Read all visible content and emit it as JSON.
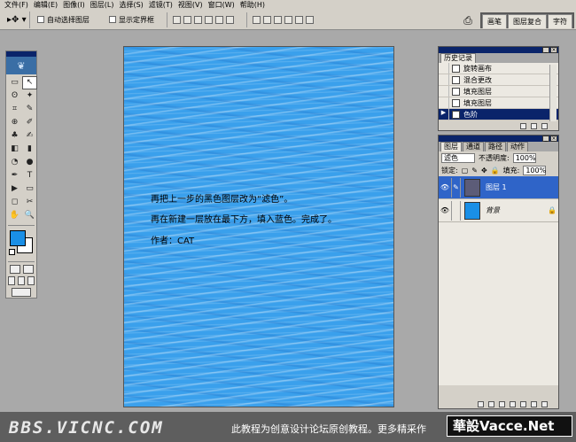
{
  "menu": [
    "文件(F)",
    "编辑(E)",
    "图像(I)",
    "图层(L)",
    "选择(S)",
    "滤镜(T)",
    "视图(V)",
    "窗口(W)",
    "帮助(H)"
  ],
  "options": {
    "auto_select_label": "自动选择图层",
    "show_bounds_label": "显示定界框",
    "right_tabs": [
      "画笔",
      "图层复合",
      "字符"
    ]
  },
  "tools": [
    "▭",
    "↖",
    "ʘ",
    "✦",
    "⌗",
    "✎",
    "⊕",
    "✐",
    "♣",
    "✍",
    "◧",
    "▮",
    "◔",
    "●",
    "✒",
    "T",
    "▶",
    "▭",
    "◻",
    "✂",
    "✋",
    "🔍"
  ],
  "canvas_text": [
    "再把上一步的黑色图层改为“滤色”。",
    "再在新建一层放在最下方，填入蓝色。完成了。",
    "作者：CAT"
  ],
  "history": {
    "tab": "历史记录",
    "items": [
      {
        "label": "旋转画布",
        "selected": false
      },
      {
        "label": "混合更改",
        "selected": false
      },
      {
        "label": "填充图层",
        "selected": false
      },
      {
        "label": "填充图层",
        "selected": false
      },
      {
        "label": "色阶",
        "selected": true
      }
    ]
  },
  "layers": {
    "tabs": [
      "图层",
      "通道",
      "路径",
      "动作"
    ],
    "blend_mode": "滤色",
    "opacity_label": "不透明度:",
    "opacity": "100%",
    "lock_label": "锁定:",
    "fill_label": "填充:",
    "fill": "100%",
    "rows": [
      {
        "name": "图层 1",
        "thumb_color": "#6a6a8a",
        "selected": true
      },
      {
        "name": "背景",
        "thumb_color": "#1a8fe6",
        "selected": false
      }
    ]
  },
  "footer": {
    "site_logo": "BBS.VICNC.COM",
    "notice": "此教程为创意设计论坛原创教程。更多精采作",
    "brand": "華設Vacce.Net"
  }
}
